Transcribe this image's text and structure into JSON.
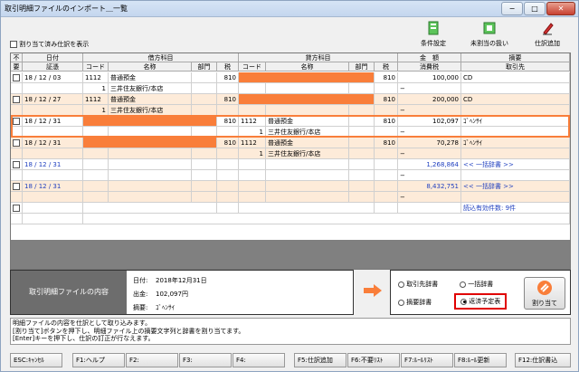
{
  "window": {
    "title": "取引明細ファイルのインポート＿一覧",
    "minimize": "−",
    "maximize": "□",
    "close": "✕"
  },
  "toolbar": {
    "show_assigned_label": "割り当て済み仕訳を表示",
    "buttons": [
      {
        "label": "条件設定",
        "icon": "filter-settings-icon",
        "color": "#2e9c3a"
      },
      {
        "label": "未割当の扱い",
        "icon": "unassigned-icon",
        "color": "#2e9c3a"
      },
      {
        "label": "仕訳追加",
        "icon": "pencil-icon",
        "color": "#cc2222"
      }
    ]
  },
  "grid": {
    "header": {
      "fuyo": "不要",
      "date": "日付",
      "voucher": "証憑",
      "debit": "借方科目",
      "credit": "貸方科目",
      "amount": "金　額",
      "summary": "摘要",
      "code": "コード",
      "name": "名称",
      "dept": "部門",
      "tax": "税",
      "consumption_tax": "消費税",
      "partner": "取引先"
    },
    "rows": [
      {
        "date": "18 / 12 / 03",
        "dcode": "1112",
        "dname": "普通預金",
        "dtax": "810",
        "ctax": "810",
        "amount": "100,000",
        "summary": "CD",
        "sub": {
          "dcode": "1",
          "dname": "三井住友銀行/本店",
          "ctax_mark": "−"
        }
      },
      {
        "date": "18 / 12 / 27",
        "dcode": "1112",
        "dname": "普通預金",
        "dtax": "810",
        "ctax": "810",
        "amount": "200,000",
        "summary": "CD",
        "sub": {
          "dcode": "1",
          "dname": "三井住友銀行/本店",
          "ctax_mark": "−"
        }
      },
      {
        "date": "18 / 12 / 31",
        "dtax": "810",
        "ccode": "1112",
        "cname": "普通預金",
        "ctax": "810",
        "amount": "102,097",
        "summary": "ｺﾞﾍﾝｻｲ",
        "sub": {
          "ccode": "1",
          "cname": "三井住友銀行/本店",
          "ctax_mark": "−"
        }
      },
      {
        "date": "18 / 12 / 31",
        "dtax": "810",
        "ccode": "1112",
        "cname": "普通預金",
        "ctax": "810",
        "amount": "70,278",
        "summary": "ｺﾞﾍﾝｻｲ",
        "sub": {
          "ccode": "1",
          "cname": "三井住友銀行/本店",
          "ctax_mark": "−"
        }
      },
      {
        "date": "18 / 12 / 31",
        "amount": "1,268,864",
        "summary": "<< 一括辞書 >>",
        "sub": {
          "ctax_mark": "−"
        }
      },
      {
        "date": "18 / 12 / 31",
        "amount": "8,432,751",
        "summary": "<< 一括辞書 >>",
        "sub": {
          "ctax_mark": "−"
        }
      }
    ],
    "footer_note": "読込有効件数: 9件"
  },
  "info": {
    "panel_label": "取引明細ファイルの内容",
    "date_label": "日付:",
    "date_value": "2018年12月31日",
    "amount_label": "出金:",
    "amount_value": "102,097円",
    "summary_label": "摘要:",
    "summary_value": "ｺﾞﾍﾝｻｲ"
  },
  "options": {
    "partner_dict": "取引先辞書",
    "bulk_dict": "一括辞書",
    "summary_dict": "摘要辞書",
    "repayment": "返済予定表",
    "assign_button": "割り当て",
    "highlight_color": "#e00000"
  },
  "message": [
    "明細ファイルの内容を仕訳として取り込みます。",
    "[割り当て]ボタンを押下し、明細ファイル上の摘要文字列と辞書を割り当てます。",
    "[Enter]キーを押下し、仕訳の訂正が行なえます。"
  ],
  "fkeys": [
    "ESC:ｷｬﾝｾﾙ",
    "F1:ヘルプ",
    "F2:",
    "F3:",
    "F4:",
    "F5:仕訳追加",
    "F6:不要ﾘｽﾄ",
    "F7:ﾙｰﾙﾘｽﾄ",
    "F8:ﾙｰﾙ更新",
    "F12:仕訳書込"
  ],
  "colors": {
    "accent_orange": "#f97e3a",
    "row_alt": "#fdebd9",
    "blue_text": "#1f3fbf"
  }
}
